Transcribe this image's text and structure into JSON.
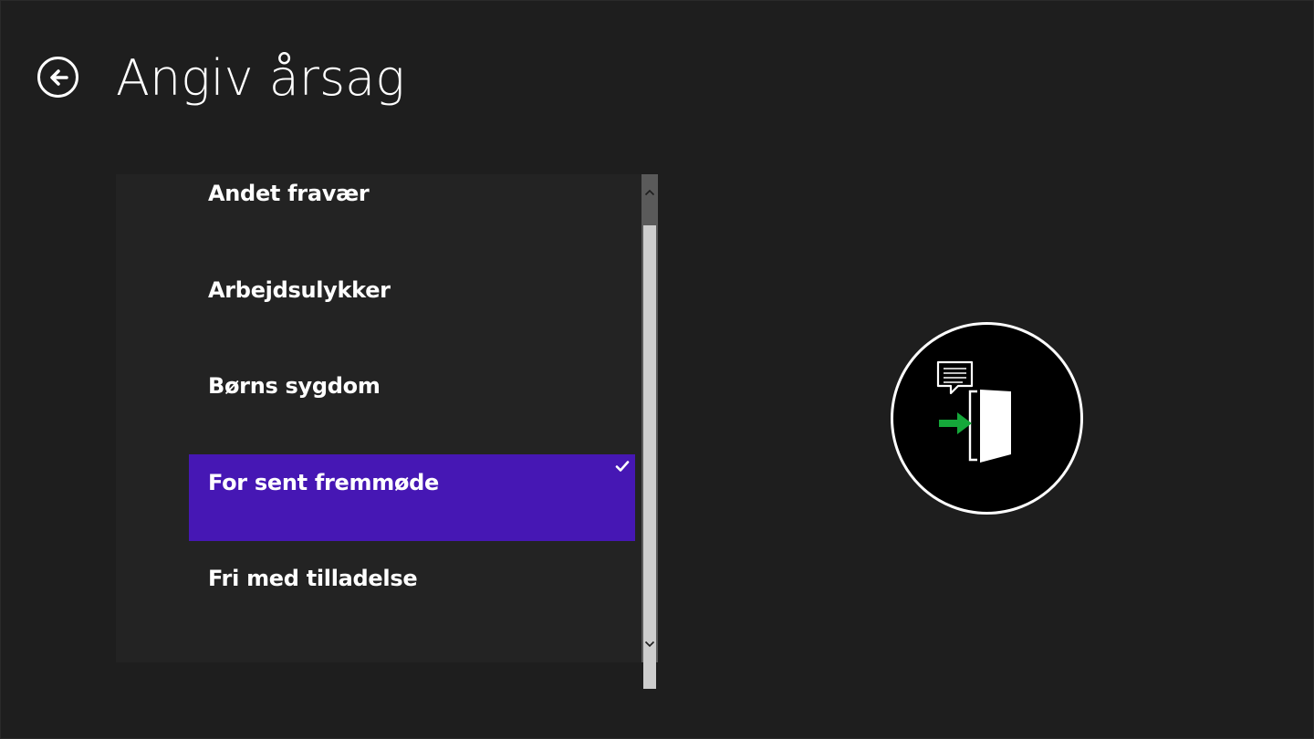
{
  "header": {
    "back_icon": "arrow-left-circle-icon",
    "title": "Angiv årsag"
  },
  "reasons": {
    "items": [
      {
        "label": "Andet fravær",
        "selected": false
      },
      {
        "label": "Arbejdsulykker",
        "selected": false
      },
      {
        "label": "Børns sygdom",
        "selected": false
      },
      {
        "label": "For sent fremmøde",
        "selected": true
      },
      {
        "label": "Fri med tilladelse",
        "selected": false
      }
    ],
    "selected_color": "#4617b4",
    "check_icon": "checkmark-icon"
  },
  "scrollbar": {
    "up_icon": "chevron-up-icon",
    "down_icon": "chevron-down-icon"
  },
  "illustration": {
    "icons": [
      "speech-bubble-icon",
      "enter-door-icon",
      "arrow-right-icon"
    ],
    "arrow_color": "#15a83a"
  }
}
